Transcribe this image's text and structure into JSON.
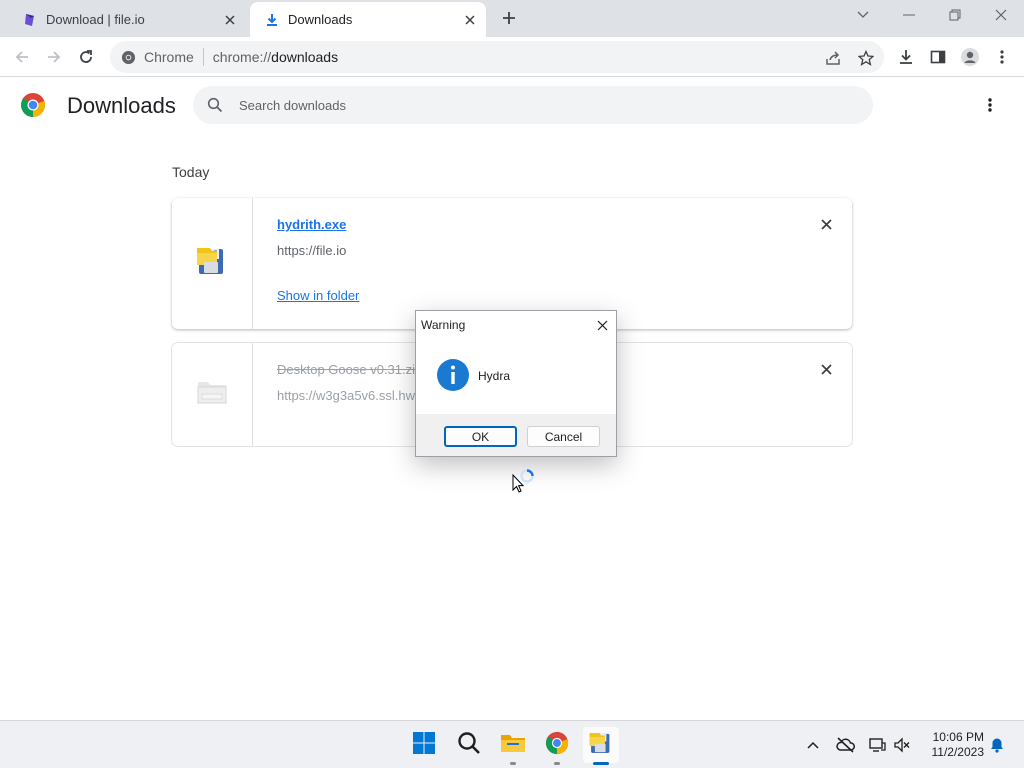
{
  "browser": {
    "tabs": [
      {
        "title": "Download | file.io",
        "active": false
      },
      {
        "title": "Downloads",
        "active": true
      }
    ],
    "omnibox": {
      "chip": "Chrome",
      "url_scheme": "chrome://",
      "url_path": "downloads"
    }
  },
  "page": {
    "title": "Downloads",
    "search_placeholder": "Search downloads",
    "section_label": "Today",
    "downloads": [
      {
        "file_name": "hydrith.exe",
        "source_url": "https://file.io",
        "action_label": "Show in folder",
        "state": "complete"
      },
      {
        "file_name": "Desktop Goose v0.31.zip",
        "source_url": "https://w3g3a5v6.ssl.hw",
        "state": "removed"
      }
    ]
  },
  "dialog": {
    "title": "Warning",
    "message": "Hydra",
    "ok_label": "OK",
    "cancel_label": "Cancel"
  },
  "taskbar": {
    "time": "10:06 PM",
    "date": "11/2/2023"
  },
  "colors": {
    "accent": "#1a73e8",
    "tabstrip": "#dee1e6",
    "taskbar": "#eef0f3",
    "info_icon": "#1a7ad1"
  }
}
